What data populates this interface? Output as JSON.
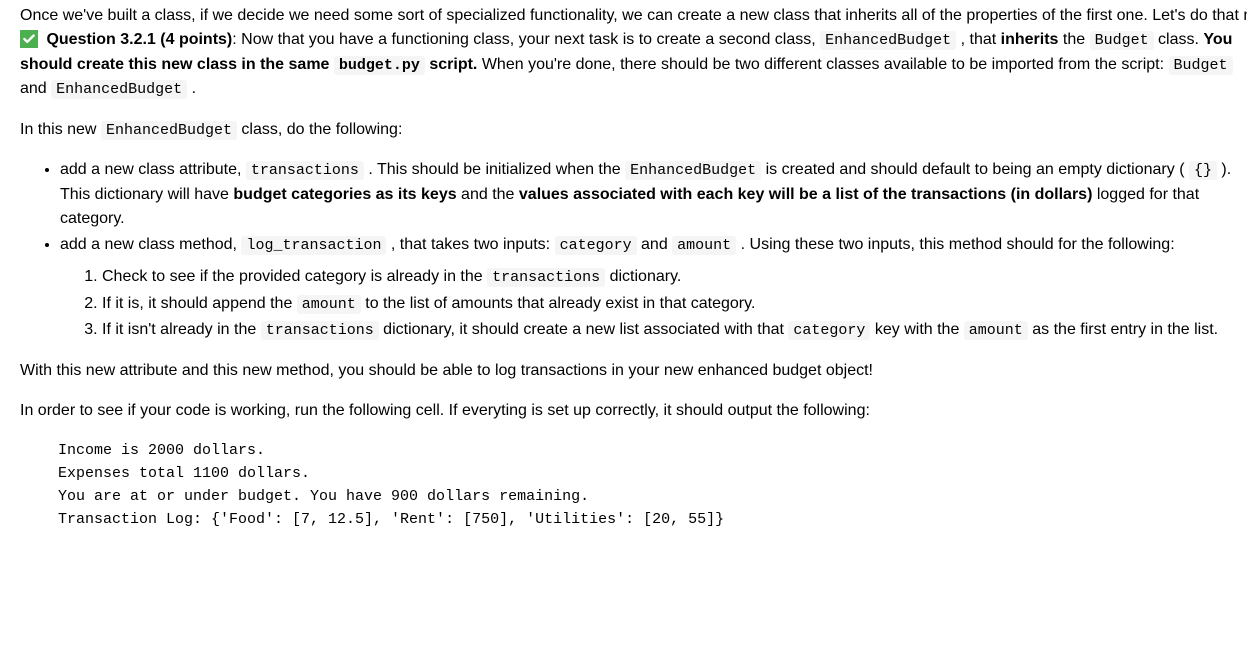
{
  "intro1": "Once we've built a class, if we decide we need some sort of specialized functionality, we can create a new class that inherits all of the properties of the first one. Let's do that now!",
  "q": {
    "label": "Question 3.2.1 (4 points)",
    "p1_a": ": Now that you have a functioning class, your next task is to create a second class, ",
    "c1": "EnhancedBudget",
    "p1_b": " , that ",
    "strong1": "inherits",
    "p1_c": " the ",
    "c2": "Budget",
    "p1_d": " class. ",
    "strong2_a": "You should create this new class in the same ",
    "c3": "budget.py",
    "strong2_b": " script.",
    "p1_e": " When you're done, there should be two different classes available to be imported from the script: ",
    "c4": "Budget",
    "p1_f": " and ",
    "c5": "EnhancedBudget",
    "p1_g": " ."
  },
  "lead": {
    "a": "In this new ",
    "c": "EnhancedBudget",
    "b": " class, do the following:"
  },
  "bullet1": {
    "a": "add a new class attribute, ",
    "c1": "transactions",
    "b": " . This should be initialized when the ",
    "c2": "EnhancedBudget",
    "c": " is created and should default to being an empty dictionary ( ",
    "c3": "{}",
    "d": " ). This dictionary will have ",
    "s1": "budget categories as its keys",
    "e": " and the ",
    "s2": "values associated with each key will be a list of the transactions (in dollars)",
    "f": " logged for that category."
  },
  "bullet2": {
    "a": "add a new class method, ",
    "c1": "log_transaction",
    "b": " , that takes two inputs: ",
    "c2": "category",
    "c": " and ",
    "c3": "amount",
    "d": " . Using these two inputs, this method should for the following:"
  },
  "steps": {
    "s1a": "Check to see if the provided category is already in the ",
    "s1c": "transactions",
    "s1b": " dictionary.",
    "s2a": "If it is, it should append the ",
    "s2c": "amount",
    "s2b": " to the list of amounts that already exist in that category.",
    "s3a": "If it isn't already in the ",
    "s3c1": "transactions",
    "s3b": " dictionary, it should create a new list associated with that ",
    "s3c2": "category",
    "s3c": " key with the ",
    "s3c3": "amount",
    "s3d": " as the first entry in the list."
  },
  "p2": "With this new attribute and this new method, you should be able to log transactions in your new enhanced budget object!",
  "p3": "In order to see if your code is working, run the following cell. If everyting is set up correctly, it should output the following:",
  "output": "Income is 2000 dollars.\nExpenses total 1100 dollars.\nYou are at or under budget. You have 900 dollars remaining.\nTransaction Log: {'Food': [7, 12.5], 'Rent': [750], 'Utilities': [20, 55]}"
}
